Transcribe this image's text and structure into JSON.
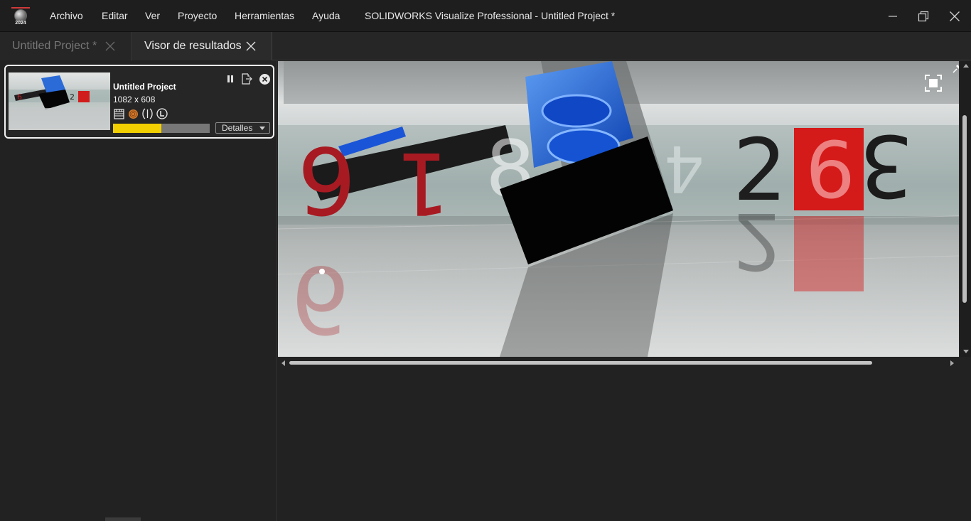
{
  "app": {
    "logo_icon": "solidworks-visualize-logo-icon",
    "logo_year": "2024",
    "window_title": "SOLIDWORKS Visualize Professional - Untitled Project *"
  },
  "menu": {
    "items": [
      "Archivo",
      "Editar",
      "Ver",
      "Proyecto",
      "Herramientas",
      "Ayuda"
    ]
  },
  "window_controls": [
    "minimize-icon",
    "restore-icon",
    "close-icon"
  ],
  "tabs": [
    {
      "label": "Untitled Project *",
      "active": false
    },
    {
      "label": "Visor de resultados",
      "active": true
    }
  ],
  "render_job": {
    "name": "Untitled Project",
    "resolution": "1082 x 608",
    "progress_fraction": 0.5,
    "details_label": "Detalles",
    "status_icons": [
      "clapperboard-icon",
      "texture-ball-icon",
      "denoiser-icon",
      "layers-L-icon"
    ],
    "actions": [
      "pause-icon",
      "export-icon",
      "cancel-icon"
    ]
  },
  "colors": {
    "accent_progress": "#f2cf00",
    "background": "#212121",
    "card_border": "#f2f2f2"
  }
}
